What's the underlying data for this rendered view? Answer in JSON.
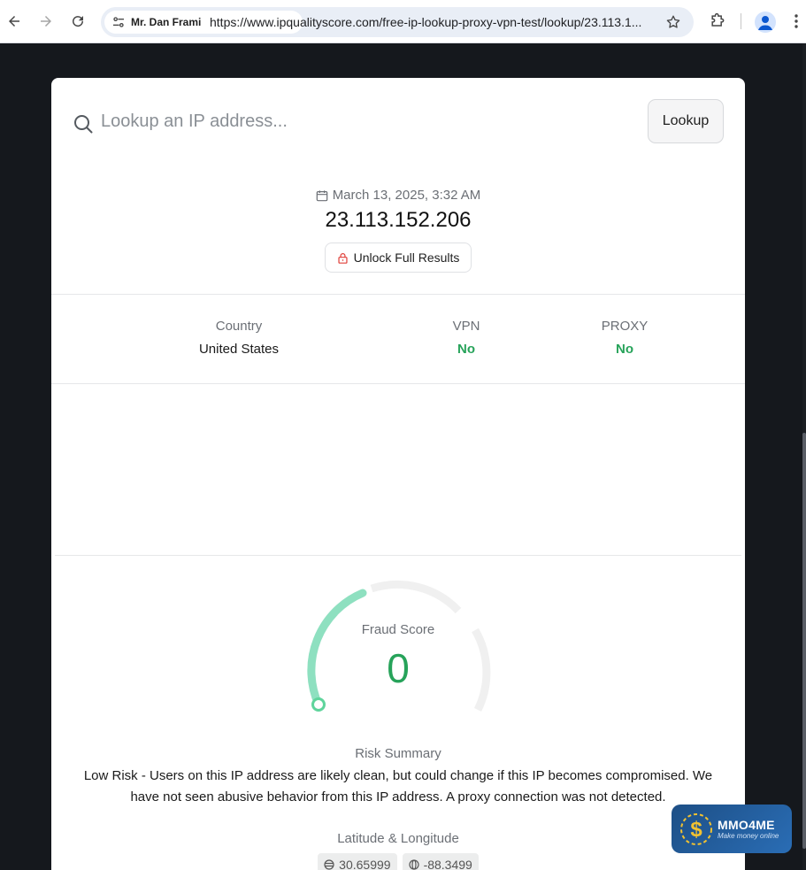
{
  "browser": {
    "site_chip": "Mr. Dan Frami",
    "url": "https://www.ipqualityscore.com/free-ip-lookup-proxy-vpn-test/lookup/23.113.1..."
  },
  "search": {
    "placeholder": "Lookup an IP address...",
    "button_label": "Lookup"
  },
  "result": {
    "date": "March 13, 2025, 3:32 AM",
    "ip": "23.113.152.206",
    "unlock_label": "Unlock Full Results"
  },
  "stats": {
    "country": {
      "label": "Country",
      "value": "United States"
    },
    "vpn": {
      "label": "VPN",
      "value": "No"
    },
    "proxy": {
      "label": "PROXY",
      "value": "No"
    }
  },
  "fraud": {
    "label": "Fraud Score",
    "score": "0",
    "fill_fraction": 0.0,
    "accent": "#27a35a",
    "arc_color": "#8ee0c0"
  },
  "risk": {
    "title": "Risk Summary",
    "text": "Low Risk - Users on this IP address are likely clean, but could change if this IP becomes compromised. We have not seen abusive behavior from this IP address. A proxy connection was not detected."
  },
  "location": {
    "title": "Latitude & Longitude",
    "latitude": "30.65999",
    "longitude": "-88.3499"
  },
  "watermark": {
    "brand": "MMO4ME",
    "tagline": "Make money online"
  }
}
